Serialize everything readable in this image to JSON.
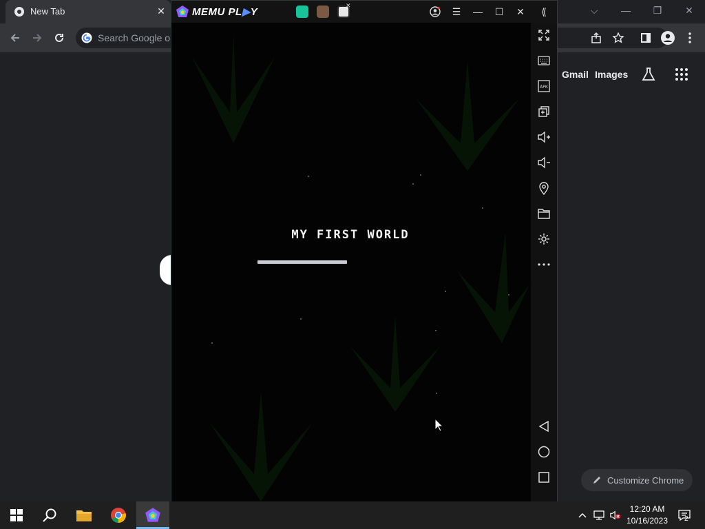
{
  "chrome": {
    "tab_title": "New Tab",
    "tab_close": "✕",
    "omnibox_placeholder": "Search Google or type a URL",
    "ntp_links": {
      "gmail": "Gmail",
      "images": "Images"
    },
    "customize_label": "Customize Chrome",
    "window_controls": {
      "dropdown": "⌵",
      "minimize": "—",
      "restore": "❐",
      "close": "✕"
    }
  },
  "memu": {
    "brand_prefix": "MEMU PL",
    "brand_accent": "▶",
    "brand_suffix": "Y",
    "controls": {
      "menu": "☰",
      "minimize": "—",
      "maximize": "☐",
      "close": "✕",
      "collapse": "⟪"
    },
    "sidebar_items": [
      "fullscreen-icon",
      "keyboard-icon",
      "apk-icon",
      "multi-window-icon",
      "volume-up-icon",
      "volume-down-icon",
      "location-icon",
      "folder-icon",
      "settings-icon",
      "more-icon"
    ],
    "nav_items": [
      "back-icon",
      "home-icon",
      "recents-icon"
    ]
  },
  "game": {
    "world_title": "MY FIRST WORLD",
    "progress": 0.5
  },
  "taskbar": {
    "time": "12:20 AM",
    "date": "10/16/2023",
    "notification_count": "2"
  },
  "colors": {
    "memu_accent": "#5b8cff",
    "progress_fill": "#c7ccd6",
    "taskbar_highlight": "#76b9ed"
  }
}
